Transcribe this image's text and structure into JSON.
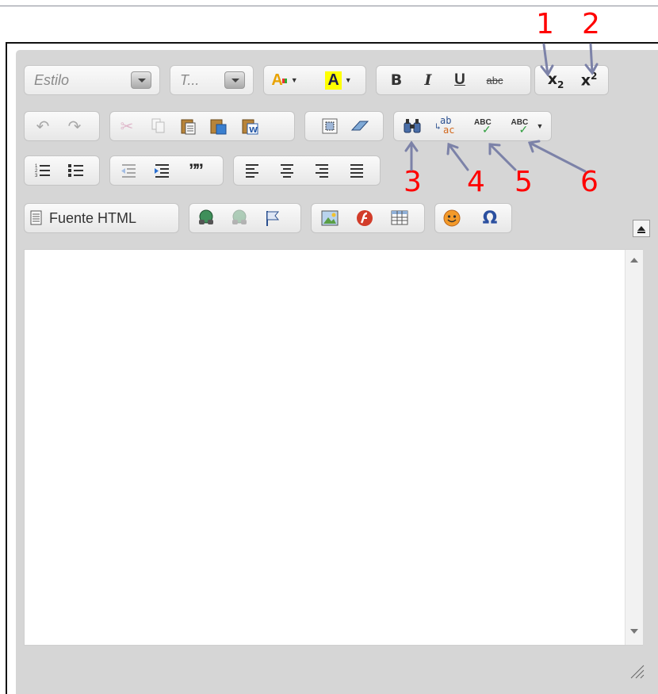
{
  "toolbar": {
    "style_combo": {
      "label": "Estilo"
    },
    "size_combo": {
      "label": "T..."
    },
    "bold_label": "B",
    "italic_label": "I",
    "underline_label": "U",
    "strike_label": "abc",
    "subscript_label": "x",
    "subscript_sub": "2",
    "superscript_label": "x",
    "superscript_sup": "2",
    "text_color_label": "A",
    "bg_color_label": "A",
    "spell_label": "ABC",
    "scayt_label": "ABC",
    "replace_top": "ab",
    "replace_bottom": "ac",
    "source_label": "Fuente HTML",
    "blockquote_label": "””",
    "special_char_label": "Ω"
  },
  "annotations": [
    "1",
    "2",
    "3",
    "4",
    "5",
    "6"
  ],
  "colors": {
    "annotation": "#ff0000",
    "arrow": "#7c82a8",
    "toolbar_bg": "#d6d6d6",
    "content_bg": "#ffffff",
    "text_highlight": "#ffff00"
  }
}
